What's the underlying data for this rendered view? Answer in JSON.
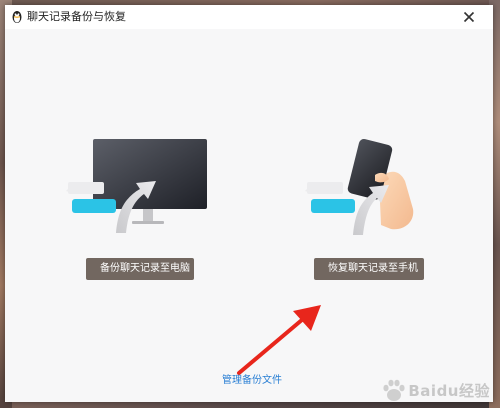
{
  "window": {
    "title": "聊天记录备份与恢复",
    "close_icon": "close-icon"
  },
  "actions": {
    "backup_label": "备份聊天记录至电脑",
    "restore_label": "恢复聊天记录至手机"
  },
  "footer": {
    "manage_link": "管理备份文件"
  },
  "watermark": {
    "text": "Baidu经验"
  },
  "colors": {
    "button_bg": "#726760",
    "link": "#2a7fd4",
    "arrow_annotation": "#e8261c",
    "accent_cyan": "#2bc3e6"
  }
}
